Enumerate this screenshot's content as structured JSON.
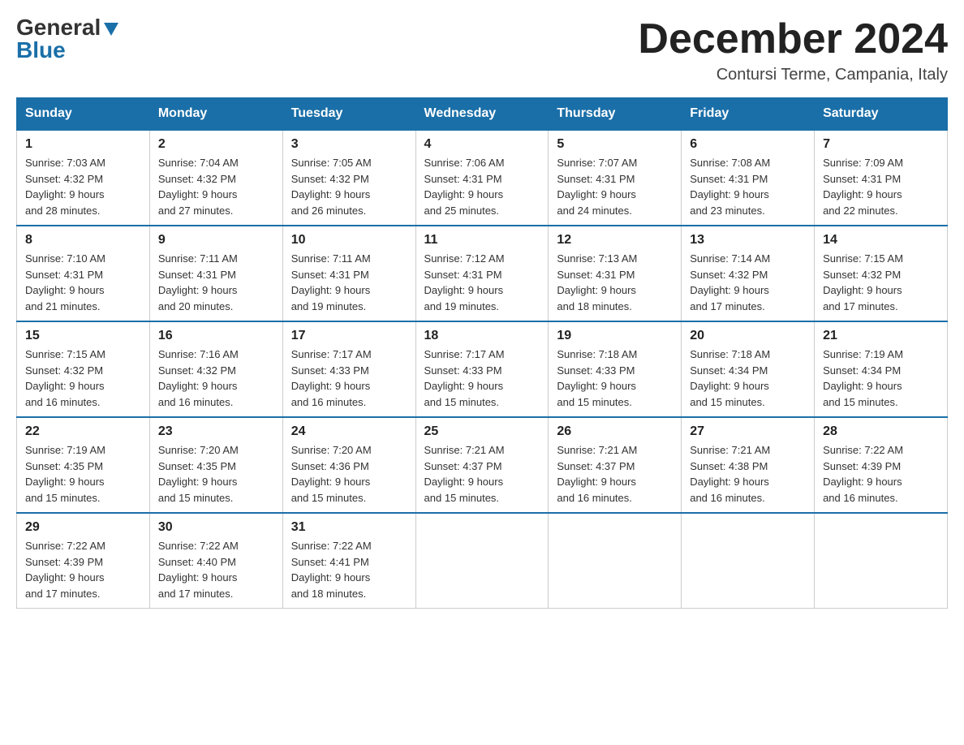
{
  "logo": {
    "general": "General",
    "blue": "Blue"
  },
  "header": {
    "month": "December 2024",
    "location": "Contursi Terme, Campania, Italy"
  },
  "weekdays": [
    "Sunday",
    "Monday",
    "Tuesday",
    "Wednesday",
    "Thursday",
    "Friday",
    "Saturday"
  ],
  "weeks": [
    [
      {
        "day": "1",
        "sunrise": "7:03 AM",
        "sunset": "4:32 PM",
        "daylight": "9 hours and 28 minutes."
      },
      {
        "day": "2",
        "sunrise": "7:04 AM",
        "sunset": "4:32 PM",
        "daylight": "9 hours and 27 minutes."
      },
      {
        "day": "3",
        "sunrise": "7:05 AM",
        "sunset": "4:32 PM",
        "daylight": "9 hours and 26 minutes."
      },
      {
        "day": "4",
        "sunrise": "7:06 AM",
        "sunset": "4:31 PM",
        "daylight": "9 hours and 25 minutes."
      },
      {
        "day": "5",
        "sunrise": "7:07 AM",
        "sunset": "4:31 PM",
        "daylight": "9 hours and 24 minutes."
      },
      {
        "day": "6",
        "sunrise": "7:08 AM",
        "sunset": "4:31 PM",
        "daylight": "9 hours and 23 minutes."
      },
      {
        "day": "7",
        "sunrise": "7:09 AM",
        "sunset": "4:31 PM",
        "daylight": "9 hours and 22 minutes."
      }
    ],
    [
      {
        "day": "8",
        "sunrise": "7:10 AM",
        "sunset": "4:31 PM",
        "daylight": "9 hours and 21 minutes."
      },
      {
        "day": "9",
        "sunrise": "7:11 AM",
        "sunset": "4:31 PM",
        "daylight": "9 hours and 20 minutes."
      },
      {
        "day": "10",
        "sunrise": "7:11 AM",
        "sunset": "4:31 PM",
        "daylight": "9 hours and 19 minutes."
      },
      {
        "day": "11",
        "sunrise": "7:12 AM",
        "sunset": "4:31 PM",
        "daylight": "9 hours and 19 minutes."
      },
      {
        "day": "12",
        "sunrise": "7:13 AM",
        "sunset": "4:31 PM",
        "daylight": "9 hours and 18 minutes."
      },
      {
        "day": "13",
        "sunrise": "7:14 AM",
        "sunset": "4:32 PM",
        "daylight": "9 hours and 17 minutes."
      },
      {
        "day": "14",
        "sunrise": "7:15 AM",
        "sunset": "4:32 PM",
        "daylight": "9 hours and 17 minutes."
      }
    ],
    [
      {
        "day": "15",
        "sunrise": "7:15 AM",
        "sunset": "4:32 PM",
        "daylight": "9 hours and 16 minutes."
      },
      {
        "day": "16",
        "sunrise": "7:16 AM",
        "sunset": "4:32 PM",
        "daylight": "9 hours and 16 minutes."
      },
      {
        "day": "17",
        "sunrise": "7:17 AM",
        "sunset": "4:33 PM",
        "daylight": "9 hours and 16 minutes."
      },
      {
        "day": "18",
        "sunrise": "7:17 AM",
        "sunset": "4:33 PM",
        "daylight": "9 hours and 15 minutes."
      },
      {
        "day": "19",
        "sunrise": "7:18 AM",
        "sunset": "4:33 PM",
        "daylight": "9 hours and 15 minutes."
      },
      {
        "day": "20",
        "sunrise": "7:18 AM",
        "sunset": "4:34 PM",
        "daylight": "9 hours and 15 minutes."
      },
      {
        "day": "21",
        "sunrise": "7:19 AM",
        "sunset": "4:34 PM",
        "daylight": "9 hours and 15 minutes."
      }
    ],
    [
      {
        "day": "22",
        "sunrise": "7:19 AM",
        "sunset": "4:35 PM",
        "daylight": "9 hours and 15 minutes."
      },
      {
        "day": "23",
        "sunrise": "7:20 AM",
        "sunset": "4:35 PM",
        "daylight": "9 hours and 15 minutes."
      },
      {
        "day": "24",
        "sunrise": "7:20 AM",
        "sunset": "4:36 PM",
        "daylight": "9 hours and 15 minutes."
      },
      {
        "day": "25",
        "sunrise": "7:21 AM",
        "sunset": "4:37 PM",
        "daylight": "9 hours and 15 minutes."
      },
      {
        "day": "26",
        "sunrise": "7:21 AM",
        "sunset": "4:37 PM",
        "daylight": "9 hours and 16 minutes."
      },
      {
        "day": "27",
        "sunrise": "7:21 AM",
        "sunset": "4:38 PM",
        "daylight": "9 hours and 16 minutes."
      },
      {
        "day": "28",
        "sunrise": "7:22 AM",
        "sunset": "4:39 PM",
        "daylight": "9 hours and 16 minutes."
      }
    ],
    [
      {
        "day": "29",
        "sunrise": "7:22 AM",
        "sunset": "4:39 PM",
        "daylight": "9 hours and 17 minutes."
      },
      {
        "day": "30",
        "sunrise": "7:22 AM",
        "sunset": "4:40 PM",
        "daylight": "9 hours and 17 minutes."
      },
      {
        "day": "31",
        "sunrise": "7:22 AM",
        "sunset": "4:41 PM",
        "daylight": "9 hours and 18 minutes."
      },
      null,
      null,
      null,
      null
    ]
  ],
  "labels": {
    "sunrise": "Sunrise:",
    "sunset": "Sunset:",
    "daylight": "Daylight:"
  }
}
